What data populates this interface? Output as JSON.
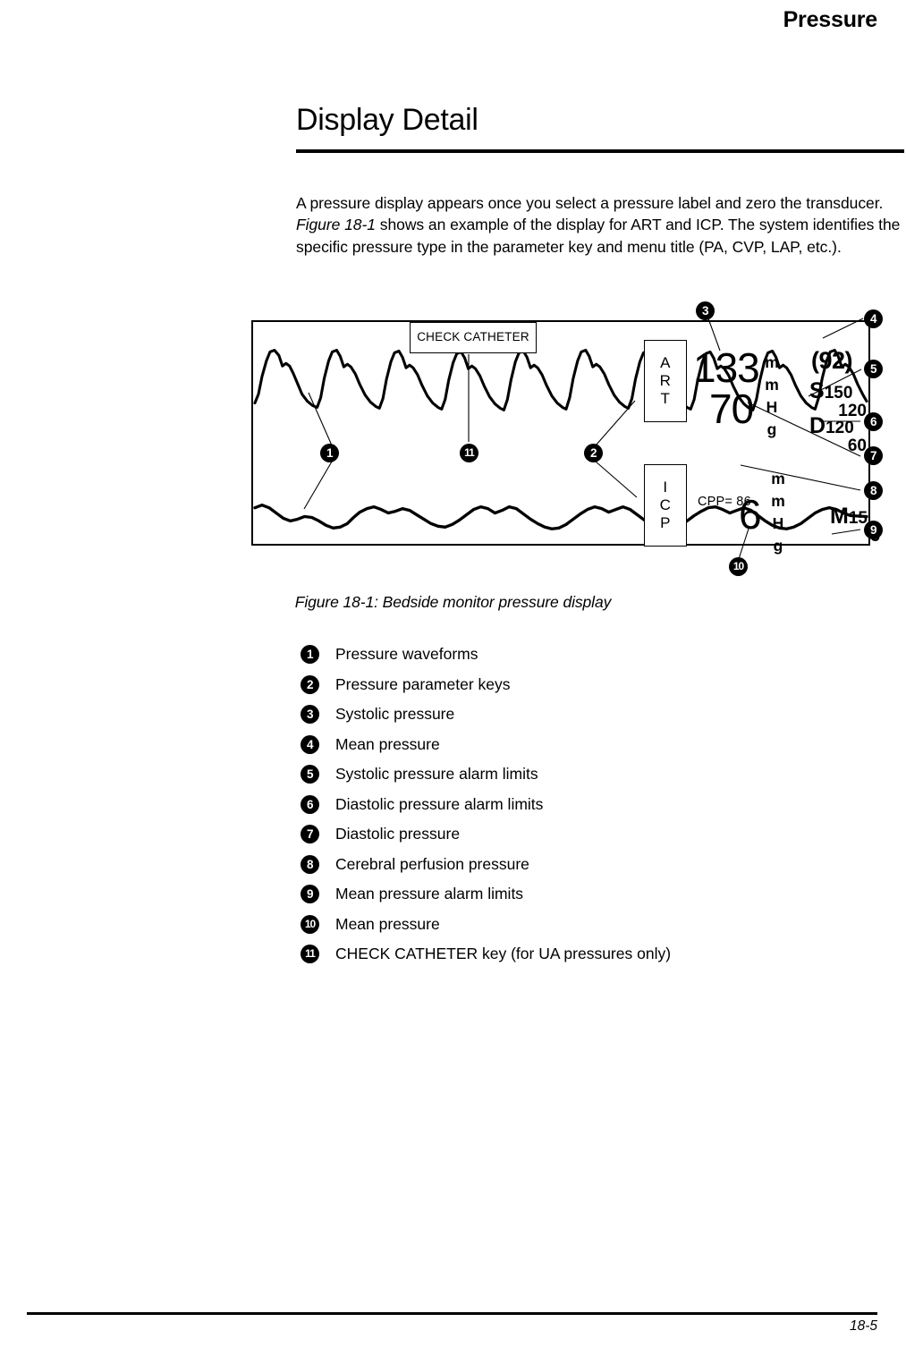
{
  "header": {
    "running_head": "Pressure"
  },
  "section": {
    "title": "Display Detail",
    "intro_part1": "A pressure display appears once you select a pressure label and zero the transducer. ",
    "intro_emphasis": "Figure 18-1",
    "intro_part2": " shows an example of the display for ART and ICP. The system identifies the specific pressure type in the parameter key and menu title (PA, CVP, LAP, etc.)."
  },
  "figure": {
    "caption": "Figure 18-1: Bedside monitor pressure display",
    "check_catheter_key": "CHECK CATHETER",
    "param_keys": [
      {
        "name": "art",
        "letters": [
          "A",
          "R",
          "T"
        ]
      },
      {
        "name": "icp",
        "letters": [
          "I",
          "C",
          "P"
        ]
      }
    ],
    "art_systolic": "133",
    "art_diastolic": "70",
    "art_mean": "(92)",
    "art_units": [
      "m",
      "m",
      "H",
      "g"
    ],
    "systolic_alarm": {
      "letter": "S",
      "high": "150",
      "low": "120"
    },
    "diastolic_alarm": {
      "letter": "D",
      "high": "120",
      "low": "60"
    },
    "cpp_label": "CPP= 86",
    "icp_value": "6",
    "icp_units": [
      "m",
      "m",
      "H",
      "g"
    ],
    "mean_alarm": {
      "letter": "M",
      "high": "15",
      "low": "5"
    },
    "callouts": [
      {
        "num": "1"
      },
      {
        "num": "2"
      },
      {
        "num": "3"
      },
      {
        "num": "4"
      },
      {
        "num": "5"
      },
      {
        "num": "6"
      },
      {
        "num": "7"
      },
      {
        "num": "8"
      },
      {
        "num": "9"
      },
      {
        "num": "10"
      },
      {
        "num": "11"
      }
    ]
  },
  "legend": {
    "items": [
      {
        "num": "1",
        "label": "Pressure waveforms"
      },
      {
        "num": "2",
        "label": "Pressure parameter keys"
      },
      {
        "num": "3",
        "label": "Systolic pressure"
      },
      {
        "num": "4",
        "label": "Mean pressure"
      },
      {
        "num": "5",
        "label": "Systolic pressure alarm limits"
      },
      {
        "num": "6",
        "label": "Diastolic pressure alarm limits"
      },
      {
        "num": "7",
        "label": "Diastolic pressure"
      },
      {
        "num": "8",
        "label": "Cerebral perfusion pressure"
      },
      {
        "num": "9",
        "label": "Mean pressure alarm limits"
      },
      {
        "num": "10",
        "label": "Mean pressure"
      },
      {
        "num": "11",
        "label": "CHECK CATHETER key (for UA pressures only)"
      }
    ]
  },
  "footer": {
    "page_number": "18-5"
  }
}
